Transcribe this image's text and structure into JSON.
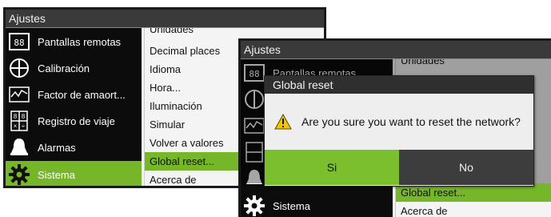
{
  "screen1": {
    "title": "Ajustes",
    "sidebar": [
      {
        "label": "Pantallas remotas",
        "icon": "remote-displays-icon"
      },
      {
        "label": "Calibración",
        "icon": "calibration-icon"
      },
      {
        "label": "Factor de amaort...",
        "icon": "damping-icon"
      },
      {
        "label": "Registro de viaje",
        "icon": "trip-log-icon"
      },
      {
        "label": "Alarmas",
        "icon": "bell-icon"
      },
      {
        "label": "Sistema",
        "icon": "gear-icon",
        "active": true
      }
    ],
    "submenu": [
      "Unidades",
      "Decimal places",
      "Idioma",
      "Hora...",
      "Iluminación",
      "Simular",
      "Volver a valores",
      "Global reset...",
      "Acerca de"
    ],
    "submenu_active": "Global reset..."
  },
  "screen2": {
    "title": "Ajustes",
    "sidebar_visible": [
      "Pantallas remotas",
      "Sistema"
    ],
    "submenu_visible": [
      "Unidades",
      "Global reset...",
      "Acerca de"
    ],
    "dialog": {
      "title": "Global reset",
      "message": "Are you sure you want to reset the network?",
      "yes_label": "Si",
      "no_label": "No"
    }
  },
  "colors": {
    "accent_green": "#76b72a",
    "titlebar": "#3a3a3a",
    "dialog_no": "#3d3d3d"
  }
}
